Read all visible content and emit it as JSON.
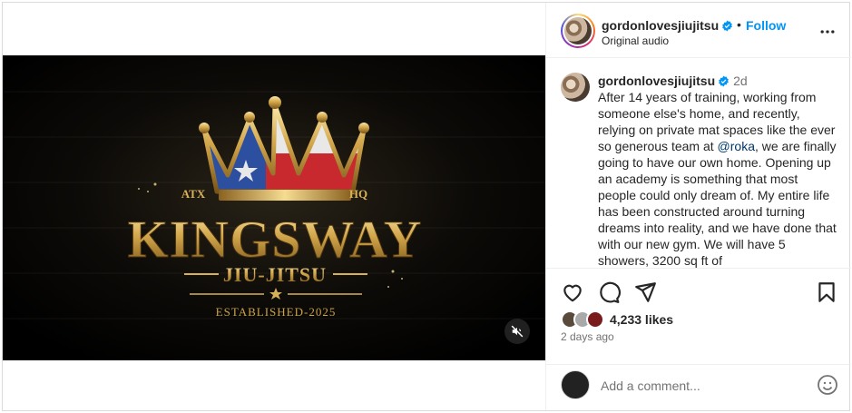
{
  "post": {
    "username": "gordonlovesjiujitsu",
    "follow_label": "Follow",
    "separator": "•",
    "audio": "Original audio",
    "caption": {
      "username": "gordonlovesjiujitsu",
      "age": "2d",
      "text_before_mention": "After 14 years of training, working from someone else's home, and recently, relying on private mat spaces like the ever so generous team at ",
      "mention": "@roka",
      "text_after_mention": ", we are finally going to have our own home. Opening up an academy is something that most people could only dream of. My entire life has been constructed around turning dreams into reality, and we have done that with our new gym. We will have 5 showers, 3200 sq ft of"
    },
    "likes": "4,233 likes",
    "time_ago": "2 days ago",
    "comment_placeholder": "Add a comment..."
  },
  "video_art": {
    "left_tag": "ATX",
    "right_tag": "HQ",
    "brand": "KINGSWAY",
    "subtitle": "JIU-JITSU",
    "established": "ESTABLISHED-2025"
  },
  "icons": {
    "more": "more-options-icon",
    "like": "heart-icon",
    "comment": "comment-icon",
    "share": "share-icon",
    "save": "bookmark-icon",
    "mute": "muted-speaker-icon",
    "emoji": "emoji-icon",
    "verified": "verified-badge-icon"
  },
  "colors": {
    "follow_blue": "#0095f6",
    "mention_blue": "#00376b",
    "muted_text": "#737373",
    "gold": "#c9a24a"
  }
}
